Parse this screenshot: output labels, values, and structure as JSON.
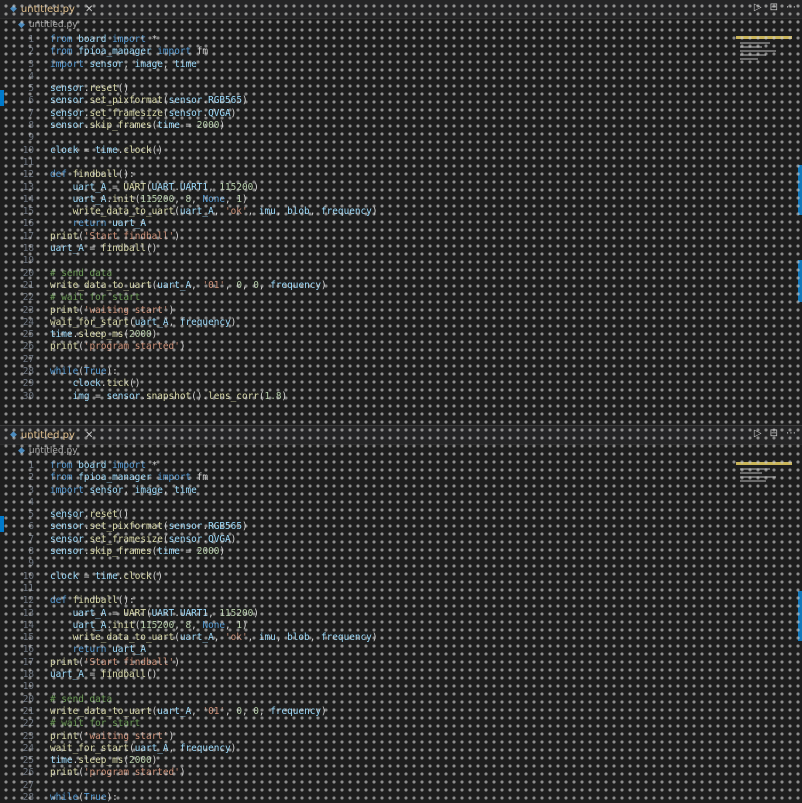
{
  "top_pane": {
    "tab_label": "untitled.py",
    "breadcrumb": "untitled.py",
    "action_icons": [
      "▷",
      "⊟",
      "⋯"
    ],
    "first_line": 1,
    "lines": [
      [
        [
          "k",
          "from "
        ],
        [
          "v",
          "board "
        ],
        [
          "k",
          "import "
        ],
        [
          "t",
          "*"
        ]
      ],
      [
        [
          "k",
          "from "
        ],
        [
          "v",
          "fpioa_manager "
        ],
        [
          "k",
          "import "
        ],
        [
          "t",
          "fm"
        ]
      ],
      [
        [
          "k",
          "import "
        ],
        [
          "v",
          "sensor"
        ],
        [
          "t",
          ", "
        ],
        [
          "v",
          "image"
        ],
        [
          "t",
          ", "
        ],
        [
          "v",
          "time"
        ]
      ],
      [],
      [
        [
          "v",
          "sensor"
        ],
        [
          "t",
          "."
        ],
        [
          "f",
          "reset"
        ],
        [
          "t",
          "()"
        ]
      ],
      [
        [
          "v",
          "sensor"
        ],
        [
          "t",
          "."
        ],
        [
          "f",
          "set_pixformat"
        ],
        [
          "t",
          "("
        ],
        [
          "v",
          "sensor"
        ],
        [
          "t",
          "."
        ],
        [
          "v",
          "RGB565"
        ],
        [
          "t",
          ")"
        ]
      ],
      [
        [
          "v",
          "sensor"
        ],
        [
          "t",
          "."
        ],
        [
          "f",
          "set_framesize"
        ],
        [
          "t",
          "("
        ],
        [
          "v",
          "sensor"
        ],
        [
          "t",
          "."
        ],
        [
          "v",
          "QVGA"
        ],
        [
          "t",
          ")"
        ]
      ],
      [
        [
          "v",
          "sensor"
        ],
        [
          "t",
          "."
        ],
        [
          "f",
          "skip_frames"
        ],
        [
          "t",
          "("
        ],
        [
          "v",
          "time"
        ],
        [
          "t",
          " = "
        ],
        [
          "n",
          "2000"
        ],
        [
          "t",
          ")"
        ]
      ],
      [],
      [
        [
          "v",
          "clock"
        ],
        [
          "t",
          " = "
        ],
        [
          "v",
          "time"
        ],
        [
          "t",
          "."
        ],
        [
          "f",
          "clock"
        ],
        [
          "t",
          "()"
        ]
      ],
      [],
      [
        [
          "k",
          "def "
        ],
        [
          "f",
          "findball"
        ],
        [
          "t",
          "():"
        ]
      ],
      [
        [
          "t",
          "    "
        ],
        [
          "v",
          "uart_A"
        ],
        [
          "t",
          " = "
        ],
        [
          "f",
          "UART"
        ],
        [
          "t",
          "("
        ],
        [
          "v",
          "UART"
        ],
        [
          "t",
          "."
        ],
        [
          "v",
          "UART1"
        ],
        [
          "t",
          ", "
        ],
        [
          "n",
          "115200"
        ],
        [
          "t",
          ")"
        ]
      ],
      [
        [
          "t",
          "    "
        ],
        [
          "v",
          "uart_A"
        ],
        [
          "t",
          "."
        ],
        [
          "f",
          "init"
        ],
        [
          "t",
          "("
        ],
        [
          "n",
          "115200"
        ],
        [
          "t",
          ", "
        ],
        [
          "n",
          "8"
        ],
        [
          "t",
          ", "
        ],
        [
          "k",
          "None"
        ],
        [
          "t",
          ", "
        ],
        [
          "n",
          "1"
        ],
        [
          "t",
          ")"
        ]
      ],
      [
        [
          "t",
          "    "
        ],
        [
          "f",
          "write_data_to_uart"
        ],
        [
          "t",
          "("
        ],
        [
          "v",
          "uart_A"
        ],
        [
          "t",
          ", "
        ],
        [
          "s",
          "'ok'"
        ],
        [
          "t",
          ", "
        ],
        [
          "v",
          "imu"
        ],
        [
          "t",
          ", "
        ],
        [
          "v",
          "blob"
        ],
        [
          "t",
          ", "
        ],
        [
          "v",
          "frequency"
        ],
        [
          "t",
          ")"
        ]
      ],
      [
        [
          "t",
          "    "
        ],
        [
          "k",
          "return "
        ],
        [
          "v",
          "uart_A"
        ]
      ],
      [
        [
          "f",
          "print"
        ],
        [
          "t",
          "("
        ],
        [
          "s",
          "'Start findball'"
        ],
        [
          "t",
          ")"
        ]
      ],
      [
        [
          "v",
          "uart_A"
        ],
        [
          "t",
          " = "
        ],
        [
          "f",
          "findball"
        ],
        [
          "t",
          "()"
        ]
      ],
      [],
      [
        [
          "c",
          "# send data"
        ]
      ],
      [
        [
          "f",
          "write_data_to_uart"
        ],
        [
          "t",
          "("
        ],
        [
          "v",
          "uart_A"
        ],
        [
          "t",
          ", "
        ],
        [
          "s",
          "'01'"
        ],
        [
          "t",
          ", "
        ],
        [
          "n",
          "0"
        ],
        [
          "t",
          ", "
        ],
        [
          "n",
          "0"
        ],
        [
          "t",
          ", "
        ],
        [
          "v",
          "frequency"
        ],
        [
          "t",
          ")"
        ]
      ],
      [
        [
          "c",
          "# wait for start"
        ]
      ],
      [
        [
          "f",
          "print"
        ],
        [
          "t",
          "("
        ],
        [
          "s",
          "'waiting start'"
        ],
        [
          "t",
          ")"
        ]
      ],
      [
        [
          "f",
          "wait_for_start"
        ],
        [
          "t",
          "("
        ],
        [
          "v",
          "uart_A"
        ],
        [
          "t",
          ", "
        ],
        [
          "v",
          "frequency"
        ],
        [
          "t",
          ")"
        ]
      ],
      [
        [
          "v",
          "time"
        ],
        [
          "t",
          "."
        ],
        [
          "f",
          "sleep_ms"
        ],
        [
          "t",
          "("
        ],
        [
          "n",
          "2000"
        ],
        [
          "t",
          ")"
        ]
      ],
      [
        [
          "f",
          "print"
        ],
        [
          "t",
          "("
        ],
        [
          "s",
          "'program started'"
        ],
        [
          "t",
          ")"
        ]
      ],
      [],
      [
        [
          "k",
          "while"
        ],
        [
          "t",
          "("
        ],
        [
          "k",
          "True"
        ],
        [
          "t",
          "):"
        ]
      ],
      [
        [
          "t",
          "    "
        ],
        [
          "v",
          "clock"
        ],
        [
          "t",
          "."
        ],
        [
          "f",
          "tick"
        ],
        [
          "t",
          "()"
        ]
      ],
      [
        [
          "t",
          "    "
        ],
        [
          "v",
          "img"
        ],
        [
          "t",
          " = "
        ],
        [
          "v",
          "sensor"
        ],
        [
          "t",
          "."
        ],
        [
          "f",
          "snapshot"
        ],
        [
          "t",
          "()."
        ],
        [
          "f",
          "lens_corr"
        ],
        [
          "t",
          "("
        ],
        [
          "n",
          "1.8"
        ],
        [
          "t",
          ")"
        ]
      ]
    ]
  },
  "bottom_pane": {
    "tab_label": "untitled.py",
    "breadcrumb": "untitled.py",
    "action_icons": [
      "▷",
      "⊟",
      "⋯"
    ],
    "first_line": 1,
    "lines": [
      [
        [
          "k",
          "from "
        ],
        [
          "v",
          "board "
        ],
        [
          "k",
          "import "
        ],
        [
          "t",
          "*"
        ]
      ],
      [
        [
          "k",
          "from "
        ],
        [
          "v",
          "fpioa_manager "
        ],
        [
          "k",
          "import "
        ],
        [
          "t",
          "fm"
        ]
      ],
      [
        [
          "k",
          "import "
        ],
        [
          "v",
          "sensor"
        ],
        [
          "t",
          ", "
        ],
        [
          "v",
          "image"
        ],
        [
          "t",
          ", "
        ],
        [
          "v",
          "time"
        ]
      ],
      [],
      [
        [
          "v",
          "sensor"
        ],
        [
          "t",
          "."
        ],
        [
          "f",
          "reset"
        ],
        [
          "t",
          "()"
        ]
      ],
      [
        [
          "v",
          "sensor"
        ],
        [
          "t",
          "."
        ],
        [
          "f",
          "set_pixformat"
        ],
        [
          "t",
          "("
        ],
        [
          "v",
          "sensor"
        ],
        [
          "t",
          "."
        ],
        [
          "v",
          "RGB565"
        ],
        [
          "t",
          ")"
        ]
      ],
      [
        [
          "v",
          "sensor"
        ],
        [
          "t",
          "."
        ],
        [
          "f",
          "set_framesize"
        ],
        [
          "t",
          "("
        ],
        [
          "v",
          "sensor"
        ],
        [
          "t",
          "."
        ],
        [
          "v",
          "QVGA"
        ],
        [
          "t",
          ")"
        ]
      ],
      [
        [
          "v",
          "sensor"
        ],
        [
          "t",
          "."
        ],
        [
          "f",
          "skip_frames"
        ],
        [
          "t",
          "("
        ],
        [
          "v",
          "time"
        ],
        [
          "t",
          " = "
        ],
        [
          "n",
          "2000"
        ],
        [
          "t",
          ")"
        ]
      ],
      [],
      [
        [
          "v",
          "clock"
        ],
        [
          "t",
          " = "
        ],
        [
          "v",
          "time"
        ],
        [
          "t",
          "."
        ],
        [
          "f",
          "clock"
        ],
        [
          "t",
          "()"
        ]
      ],
      [],
      [
        [
          "k",
          "def "
        ],
        [
          "f",
          "findball"
        ],
        [
          "t",
          "():"
        ]
      ],
      [
        [
          "t",
          "    "
        ],
        [
          "v",
          "uart_A"
        ],
        [
          "t",
          " = "
        ],
        [
          "f",
          "UART"
        ],
        [
          "t",
          "("
        ],
        [
          "v",
          "UART"
        ],
        [
          "t",
          "."
        ],
        [
          "v",
          "UART1"
        ],
        [
          "t",
          ", "
        ],
        [
          "n",
          "115200"
        ],
        [
          "t",
          ")"
        ]
      ],
      [
        [
          "t",
          "    "
        ],
        [
          "v",
          "uart_A"
        ],
        [
          "t",
          "."
        ],
        [
          "f",
          "init"
        ],
        [
          "t",
          "("
        ],
        [
          "n",
          "115200"
        ],
        [
          "t",
          ", "
        ],
        [
          "n",
          "8"
        ],
        [
          "t",
          ", "
        ],
        [
          "k",
          "None"
        ],
        [
          "t",
          ", "
        ],
        [
          "n",
          "1"
        ],
        [
          "t",
          ")"
        ]
      ],
      [
        [
          "t",
          "    "
        ],
        [
          "f",
          "write_data_to_uart"
        ],
        [
          "t",
          "("
        ],
        [
          "v",
          "uart_A"
        ],
        [
          "t",
          ", "
        ],
        [
          "s",
          "'ok'"
        ],
        [
          "t",
          ", "
        ],
        [
          "v",
          "imu"
        ],
        [
          "t",
          ", "
        ],
        [
          "v",
          "blob"
        ],
        [
          "t",
          ", "
        ],
        [
          "v",
          "frequency"
        ],
        [
          "t",
          ")"
        ]
      ],
      [
        [
          "t",
          "    "
        ],
        [
          "k",
          "return "
        ],
        [
          "v",
          "uart_A"
        ]
      ],
      [
        [
          "f",
          "print"
        ],
        [
          "t",
          "("
        ],
        [
          "s",
          "'Start findball'"
        ],
        [
          "t",
          ")"
        ]
      ],
      [
        [
          "v",
          "uart_A"
        ],
        [
          "t",
          " = "
        ],
        [
          "f",
          "findball"
        ],
        [
          "t",
          "()"
        ]
      ],
      [],
      [
        [
          "c",
          "# send data"
        ]
      ],
      [
        [
          "f",
          "write_data_to_uart"
        ],
        [
          "t",
          "("
        ],
        [
          "v",
          "uart_A"
        ],
        [
          "t",
          ", "
        ],
        [
          "s",
          "'01'"
        ],
        [
          "t",
          ", "
        ],
        [
          "n",
          "0"
        ],
        [
          "t",
          ", "
        ],
        [
          "n",
          "0"
        ],
        [
          "t",
          ", "
        ],
        [
          "v",
          "frequency"
        ],
        [
          "t",
          ")"
        ]
      ],
      [
        [
          "c",
          "# wait for start"
        ]
      ],
      [
        [
          "f",
          "print"
        ],
        [
          "t",
          "("
        ],
        [
          "s",
          "'waiting start'"
        ],
        [
          "t",
          ")"
        ]
      ],
      [
        [
          "f",
          "wait_for_start"
        ],
        [
          "t",
          "("
        ],
        [
          "v",
          "uart_A"
        ],
        [
          "t",
          ", "
        ],
        [
          "v",
          "frequency"
        ],
        [
          "t",
          ")"
        ]
      ],
      [
        [
          "v",
          "time"
        ],
        [
          "t",
          "."
        ],
        [
          "f",
          "sleep_ms"
        ],
        [
          "t",
          "("
        ],
        [
          "n",
          "2000"
        ],
        [
          "t",
          ")"
        ]
      ],
      [
        [
          "f",
          "print"
        ],
        [
          "t",
          "("
        ],
        [
          "s",
          "'program started'"
        ],
        [
          "t",
          ")"
        ]
      ],
      [],
      [
        [
          "k",
          "while"
        ],
        [
          "t",
          "("
        ],
        [
          "k",
          "True"
        ],
        [
          "t",
          "):"
        ]
      ]
    ]
  },
  "colors": {
    "editor_bg": "#1e1e1e",
    "tab_bg": "#252526",
    "keyword": "#569cd6",
    "function": "#dcdcaa",
    "string": "#ce9178",
    "number": "#b5cea8",
    "comment": "#6a9955",
    "variable": "#9cdcfe",
    "accent": "#007acc"
  },
  "icons": [
    "python-file-icon",
    "close-icon",
    "run-icon",
    "split-editor-icon",
    "more-actions-icon"
  ]
}
